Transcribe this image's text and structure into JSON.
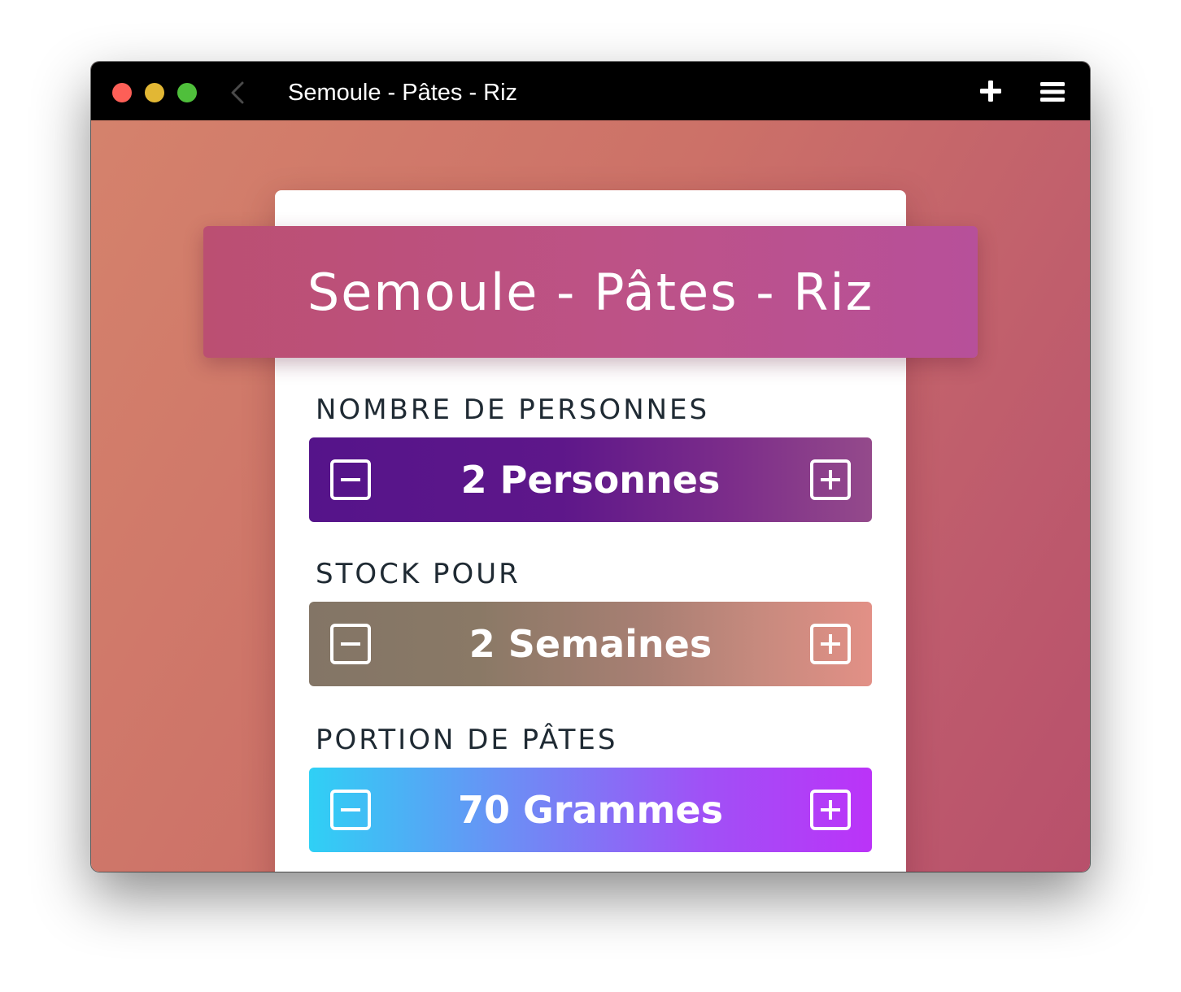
{
  "window": {
    "title": "Semoule - Pâtes - Riz",
    "controls": [
      "close",
      "minimize",
      "zoom"
    ],
    "icons": {
      "back": "chevron-left-icon",
      "add": "plus-icon",
      "menu": "hamburger-menu-icon"
    }
  },
  "header": {
    "title": "Semoule - Pâtes - Riz"
  },
  "sections": [
    {
      "label": "NOMBRE DE PERSONNES",
      "value": "2 Personnes"
    },
    {
      "label": "STOCK POUR",
      "value": "2 Semaines"
    },
    {
      "label": "PORTION DE PÂTES",
      "value": "70 Grammes"
    }
  ],
  "colors": {
    "background": "#cc7168",
    "banner": "#bd5287",
    "stepper_personnes": [
      "#55148a",
      "#944a8b"
    ],
    "stepper_semaines": [
      "#837566",
      "#e29086"
    ],
    "stepper_grammes": [
      "#2fd0f5",
      "#bb33f8"
    ]
  }
}
